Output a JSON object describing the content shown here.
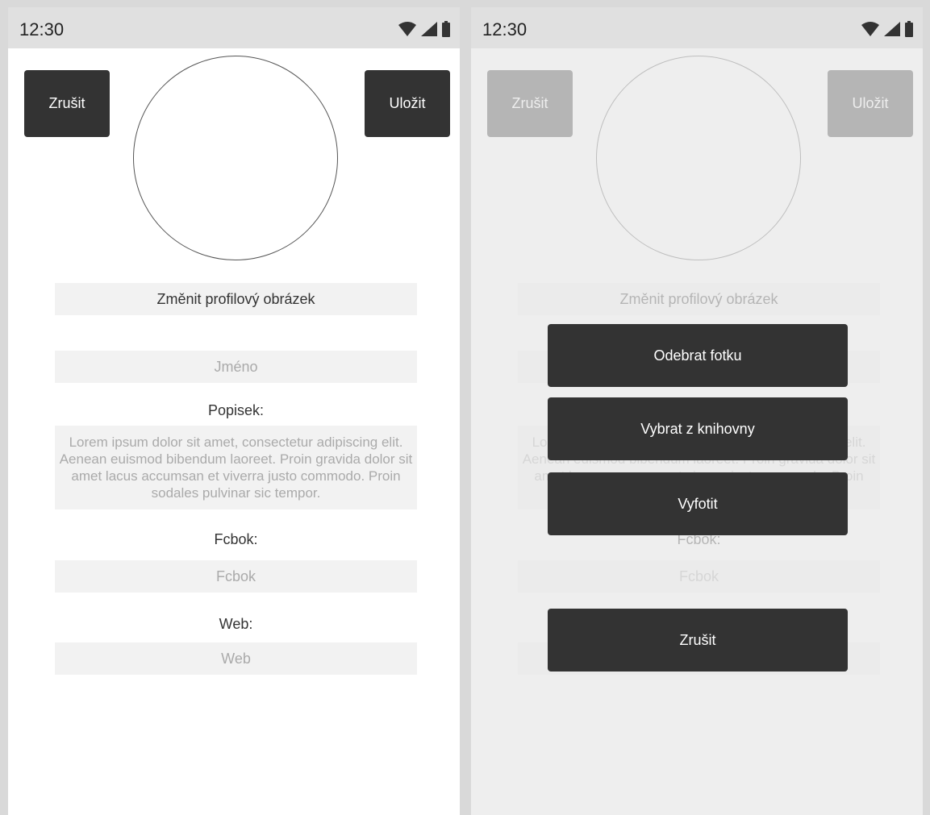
{
  "status": {
    "time": "12:30"
  },
  "header": {
    "cancel_label": "Zrušit",
    "save_label": "Uložit"
  },
  "form": {
    "change_photo_label": "Změnit profilový obrázek",
    "name_placeholder": "Jméno",
    "description_label": "Popisek:",
    "description_placeholder": "Lorem ipsum dolor sit amet, consectetur adipiscing elit. Aenean euismod bibendum laoreet. Proin gravida dolor sit amet lacus accumsan et viverra justo commodo. Proin sodales pulvinar sic tempor.",
    "fcbok_label": "Fcbok:",
    "fcbok_placeholder": "Fcbok",
    "web_label": "Web:",
    "web_placeholder": "Web"
  },
  "action_sheet": {
    "remove_photo_label": "Odebrat fotku",
    "choose_from_library_label": "Vybrat z knihovny",
    "take_photo_label": "Vyfotit",
    "cancel_label": "Zrušit"
  },
  "colors": {
    "button_bg": "#333333",
    "field_bg": "#f2f2f2",
    "statusbar_bg": "#e0e0e0"
  },
  "icons": [
    "wifi-icon",
    "signal-icon",
    "battery-icon"
  ]
}
